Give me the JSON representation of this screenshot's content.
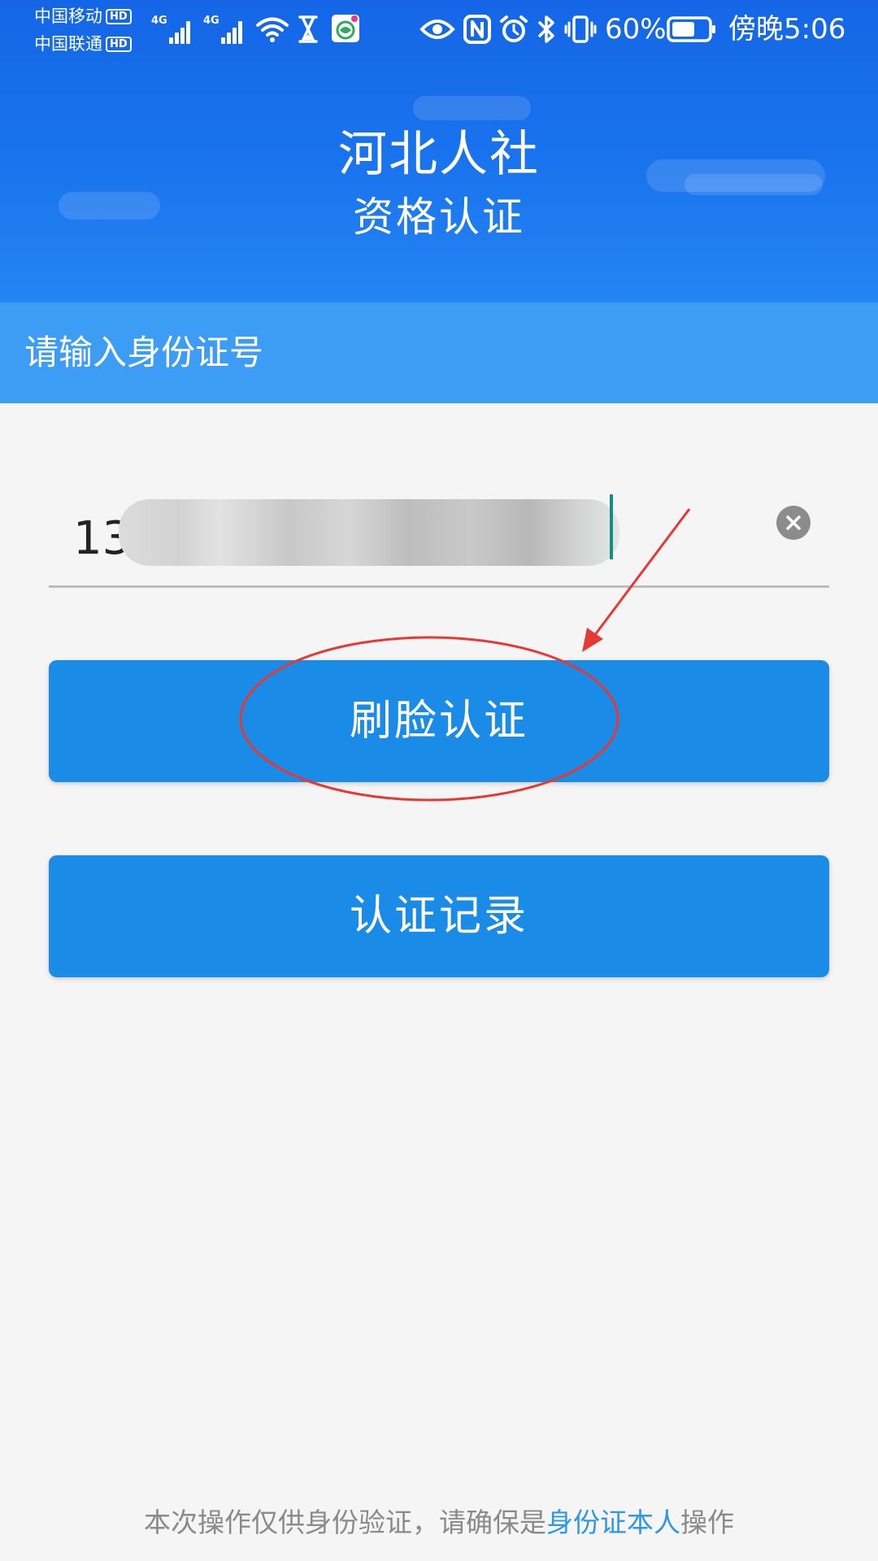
{
  "status_bar": {
    "carrier_1": "中国移动",
    "carrier_2": "中国联通",
    "hd_badge": "HD",
    "network_1": "4G",
    "network_2": "4G",
    "battery_percent": "60%",
    "time": "傍晚5:06",
    "icons": [
      "wifi-icon",
      "hourglass-icon",
      "app-notification-icon",
      "eye-icon",
      "nfc-icon",
      "alarm-icon",
      "bluetooth-icon",
      "vibrate-icon",
      "battery-icon"
    ]
  },
  "header": {
    "title": "河北人社",
    "subtitle": "资格认证"
  },
  "form": {
    "prompt": "请输入身份证号",
    "id_value": "13",
    "clear_icon": "close-icon"
  },
  "actions": {
    "face_auth": "刷脸认证",
    "records": "认证记录"
  },
  "footer": {
    "prefix": "本次操作仅供身份验证，请确保是",
    "link": "身份证本人",
    "suffix": "操作"
  },
  "colors": {
    "header_blue": "#1a74ee",
    "band_blue": "#3d9cf4",
    "button_blue": "#1a8ce8",
    "link_blue": "#2f96e8",
    "annotation_red": "#e53935",
    "background": "#f5f5f5"
  }
}
